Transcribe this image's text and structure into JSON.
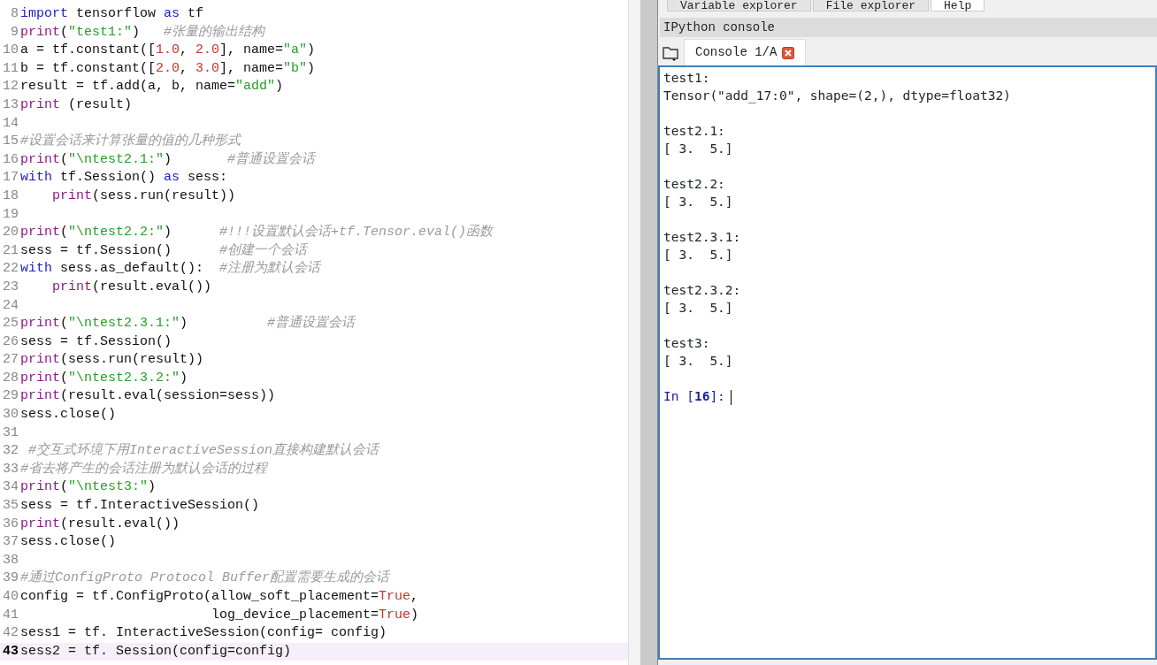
{
  "editor": {
    "lines": [
      {
        "number": "8",
        "current": false,
        "tokens": [
          {
            "kind": "kw",
            "text": "import"
          },
          {
            "kind": "plain",
            "text": " tensorflow "
          },
          {
            "kind": "kw",
            "text": "as"
          },
          {
            "kind": "plain",
            "text": " tf"
          }
        ]
      },
      {
        "number": "9",
        "current": false,
        "tokens": [
          {
            "kind": "builtin",
            "text": "print"
          },
          {
            "kind": "plain",
            "text": "("
          },
          {
            "kind": "str",
            "text": "\"test1:\""
          },
          {
            "kind": "plain",
            "text": ")   "
          },
          {
            "kind": "comment",
            "text": "#张量的输出结构"
          }
        ]
      },
      {
        "number": "10",
        "current": false,
        "tokens": [
          {
            "kind": "plain",
            "text": "a = tf.constant(["
          },
          {
            "kind": "num",
            "text": "1.0"
          },
          {
            "kind": "plain",
            "text": ", "
          },
          {
            "kind": "num",
            "text": "2.0"
          },
          {
            "kind": "plain",
            "text": "], name="
          },
          {
            "kind": "str",
            "text": "\"a\""
          },
          {
            "kind": "plain",
            "text": ")"
          }
        ]
      },
      {
        "number": "11",
        "current": false,
        "tokens": [
          {
            "kind": "plain",
            "text": "b = tf.constant(["
          },
          {
            "kind": "num",
            "text": "2.0"
          },
          {
            "kind": "plain",
            "text": ", "
          },
          {
            "kind": "num",
            "text": "3.0"
          },
          {
            "kind": "plain",
            "text": "], name="
          },
          {
            "kind": "str",
            "text": "\"b\""
          },
          {
            "kind": "plain",
            "text": ")"
          }
        ]
      },
      {
        "number": "12",
        "current": false,
        "tokens": [
          {
            "kind": "plain",
            "text": "result = tf.add(a, b, name="
          },
          {
            "kind": "str",
            "text": "\"add\""
          },
          {
            "kind": "plain",
            "text": ")"
          }
        ]
      },
      {
        "number": "13",
        "current": false,
        "tokens": [
          {
            "kind": "builtin",
            "text": "print"
          },
          {
            "kind": "plain",
            "text": " (result)"
          }
        ]
      },
      {
        "number": "14",
        "current": false
      },
      {
        "number": "15",
        "current": false,
        "tokens": [
          {
            "kind": "comment",
            "text": "#设置会话来计算张量的值的几种形式"
          }
        ]
      },
      {
        "number": "16",
        "current": false,
        "tokens": [
          {
            "kind": "builtin",
            "text": "print"
          },
          {
            "kind": "plain",
            "text": "("
          },
          {
            "kind": "str",
            "text": "\"\\ntest2.1:\""
          },
          {
            "kind": "plain",
            "text": ")       "
          },
          {
            "kind": "comment",
            "text": "#普通设置会话"
          }
        ]
      },
      {
        "number": "17",
        "current": false,
        "tokens": [
          {
            "kind": "kw",
            "text": "with"
          },
          {
            "kind": "plain",
            "text": " tf.Session() "
          },
          {
            "kind": "kw",
            "text": "as"
          },
          {
            "kind": "plain",
            "text": " sess:"
          }
        ]
      },
      {
        "number": "18",
        "current": false,
        "tokens": [
          {
            "kind": "builtin",
            "text": "    print"
          },
          {
            "kind": "plain",
            "text": "(sess.run(result))"
          }
        ]
      },
      {
        "number": "19",
        "current": false
      },
      {
        "number": "20",
        "current": false,
        "tokens": [
          {
            "kind": "builtin",
            "text": "print"
          },
          {
            "kind": "plain",
            "text": "("
          },
          {
            "kind": "str",
            "text": "\"\\ntest2.2:\""
          },
          {
            "kind": "plain",
            "text": ")      "
          },
          {
            "kind": "comment",
            "text": "#!!!设置默认会话+tf.Tensor.eval()函数"
          }
        ]
      },
      {
        "number": "21",
        "current": false,
        "tokens": [
          {
            "kind": "plain",
            "text": "sess = tf.Session()      "
          },
          {
            "kind": "comment",
            "text": "#创建一个会话"
          }
        ]
      },
      {
        "number": "22",
        "current": false,
        "tokens": [
          {
            "kind": "kw",
            "text": "with"
          },
          {
            "kind": "plain",
            "text": " sess.as_default():  "
          },
          {
            "kind": "comment",
            "text": "#注册为默认会话"
          }
        ]
      },
      {
        "number": "23",
        "current": false,
        "tokens": [
          {
            "kind": "builtin",
            "text": "    print"
          },
          {
            "kind": "plain",
            "text": "(result.eval())"
          }
        ]
      },
      {
        "number": "24",
        "current": false
      },
      {
        "number": "25",
        "current": false,
        "tokens": [
          {
            "kind": "builtin",
            "text": "print"
          },
          {
            "kind": "plain",
            "text": "("
          },
          {
            "kind": "str",
            "text": "\"\\ntest2.3.1:\""
          },
          {
            "kind": "plain",
            "text": ")          "
          },
          {
            "kind": "comment",
            "text": "#普通设置会话"
          }
        ]
      },
      {
        "number": "26",
        "current": false,
        "tokens": [
          {
            "kind": "plain",
            "text": "sess = tf.Session()"
          }
        ]
      },
      {
        "number": "27",
        "current": false,
        "tokens": [
          {
            "kind": "builtin",
            "text": "print"
          },
          {
            "kind": "plain",
            "text": "(sess.run(result))"
          }
        ]
      },
      {
        "number": "28",
        "current": false,
        "tokens": [
          {
            "kind": "builtin",
            "text": "print"
          },
          {
            "kind": "plain",
            "text": "("
          },
          {
            "kind": "str",
            "text": "\"\\ntest2.3.2:\""
          },
          {
            "kind": "plain",
            "text": ")"
          }
        ]
      },
      {
        "number": "29",
        "current": false,
        "tokens": [
          {
            "kind": "builtin",
            "text": "print"
          },
          {
            "kind": "plain",
            "text": "(result.eval(session=sess))"
          }
        ]
      },
      {
        "number": "30",
        "current": false,
        "tokens": [
          {
            "kind": "plain",
            "text": "sess.close()"
          }
        ]
      },
      {
        "number": "31",
        "current": false
      },
      {
        "number": "32",
        "current": false,
        "tokens": [
          {
            "kind": "comment",
            "text": " #交互式环境下用InteractiveSession直接构建默认会话"
          }
        ]
      },
      {
        "number": "33",
        "current": false,
        "tokens": [
          {
            "kind": "comment",
            "text": "#省去将产生的会话注册为默认会话的过程"
          }
        ]
      },
      {
        "number": "34",
        "current": false,
        "tokens": [
          {
            "kind": "builtin",
            "text": "print"
          },
          {
            "kind": "plain",
            "text": "("
          },
          {
            "kind": "str",
            "text": "\"\\ntest3:\""
          },
          {
            "kind": "plain",
            "text": ")"
          }
        ]
      },
      {
        "number": "35",
        "current": false,
        "tokens": [
          {
            "kind": "plain",
            "text": "sess = tf.InteractiveSession()"
          }
        ]
      },
      {
        "number": "36",
        "current": false,
        "tokens": [
          {
            "kind": "builtin",
            "text": "print"
          },
          {
            "kind": "plain",
            "text": "(result.eval())"
          }
        ]
      },
      {
        "number": "37",
        "current": false,
        "tokens": [
          {
            "kind": "plain",
            "text": "sess.close()"
          }
        ]
      },
      {
        "number": "38",
        "current": false
      },
      {
        "number": "39",
        "current": false,
        "tokens": [
          {
            "kind": "comment",
            "text": "#通过ConfigProto Protocol Buffer配置需要生成的会话"
          }
        ]
      },
      {
        "number": "40",
        "current": false,
        "tokens": [
          {
            "kind": "plain",
            "text": "config = tf.ConfigProto(allow_soft_placement="
          },
          {
            "kind": "num",
            "text": "True"
          },
          {
            "kind": "plain",
            "text": ","
          }
        ]
      },
      {
        "number": "41",
        "current": false,
        "tokens": [
          {
            "kind": "plain",
            "text": "                        log_device_placement="
          },
          {
            "kind": "num",
            "text": "True"
          },
          {
            "kind": "plain",
            "text": ")"
          }
        ]
      },
      {
        "number": "42",
        "current": false,
        "tokens": [
          {
            "kind": "plain",
            "text": "sess1 = tf. InteractiveSession(config= config)"
          }
        ]
      },
      {
        "number": "43",
        "current": true,
        "tokens": [
          {
            "kind": "plain",
            "text": "sess2 = tf. Session(config=config)"
          }
        ]
      }
    ]
  },
  "top_tabs": [
    {
      "label": "Variable explorer",
      "selected": false
    },
    {
      "label": "File explorer",
      "selected": false
    },
    {
      "label": "Help",
      "selected": true
    }
  ],
  "console_pane": {
    "title": "IPython console",
    "tabs": [
      {
        "label": "Console 1/A",
        "selected": true
      }
    ],
    "output": [
      {
        "label": "test1:",
        "value": "Tensor(\"add_17:0\", shape=(2,), dtype=float32)"
      },
      {
        "label": "test2.1:",
        "value": "[ 3.  5.]"
      },
      {
        "label": "test2.2:",
        "value": "[ 3.  5.]"
      },
      {
        "label": "test2.3.1:",
        "value": "[ 3.  5.]"
      },
      {
        "label": "test2.3.2:",
        "value": "[ 3.  5.]"
      },
      {
        "label": "test3:",
        "value": "[ 3.  5.]"
      }
    ],
    "prompt": {
      "prefix": "In [",
      "number": "16",
      "suffix": "]:"
    }
  }
}
